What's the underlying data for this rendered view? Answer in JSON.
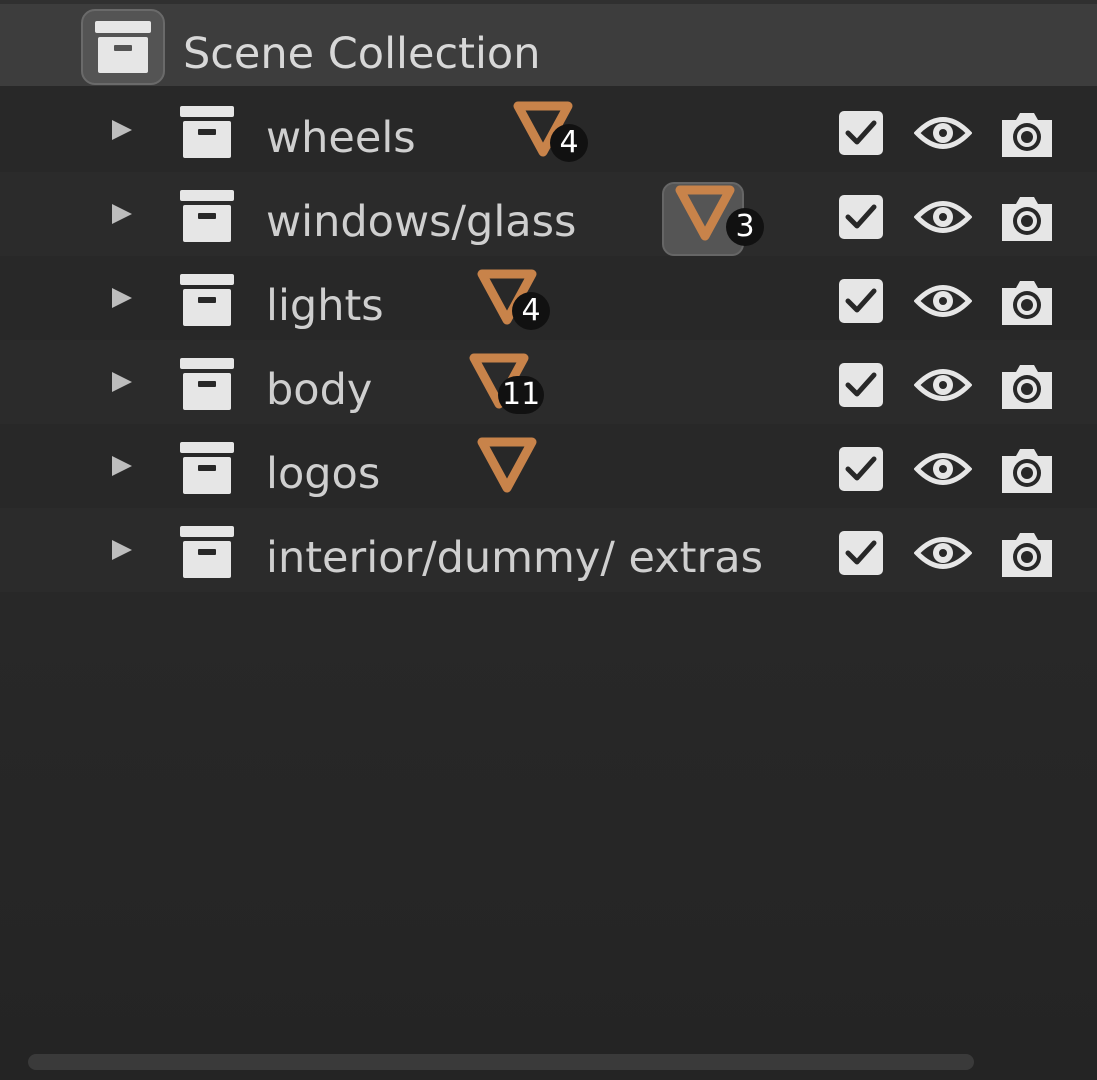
{
  "outliner": {
    "scene_collection": {
      "label": "Scene Collection",
      "icon": "collection-box-icon"
    },
    "collections": [
      {
        "label": "wheels",
        "mesh_count": "4",
        "exclude_checked": true,
        "visible": true,
        "renderable": true,
        "mesh_icon_active": false
      },
      {
        "label": "windows/glass",
        "mesh_count": "3",
        "exclude_checked": true,
        "visible": true,
        "renderable": true,
        "mesh_icon_active": true
      },
      {
        "label": "lights",
        "mesh_count": "4",
        "exclude_checked": true,
        "visible": true,
        "renderable": true,
        "mesh_icon_active": false
      },
      {
        "label": "body",
        "mesh_count": "11",
        "exclude_checked": true,
        "visible": true,
        "renderable": true,
        "mesh_icon_active": false
      },
      {
        "label": "logos",
        "mesh_count": "",
        "exclude_checked": true,
        "visible": true,
        "renderable": true,
        "mesh_icon_active": false
      },
      {
        "label": "interior/dummy/ extras",
        "mesh_count": "",
        "exclude_checked": true,
        "visible": true,
        "renderable": true,
        "mesh_icon_active": false,
        "has_mesh_icon": false
      }
    ],
    "colors": {
      "background": "#282828",
      "header_row": "#3d3d3d",
      "mesh_orange": "#c8834a",
      "icon_light": "#e6e6e6"
    }
  }
}
